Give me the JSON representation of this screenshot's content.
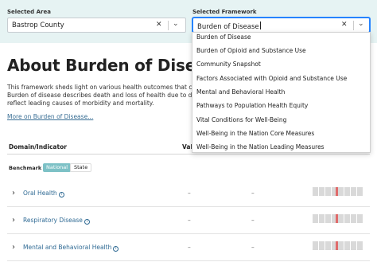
{
  "area": {
    "label": "Selected Area",
    "value": "Bastrop County",
    "clear_icon": "close-icon",
    "chevron_icon": "chevron-down-icon"
  },
  "framework": {
    "label": "Selected Framework",
    "value": "Burden of Disease",
    "clear_icon": "close-icon",
    "chevron_icon": "chevron-down-icon"
  },
  "dropdown": {
    "options": [
      "Burden of Disease",
      "Burden of Opioid and Substance Use",
      "Community Snapshot",
      "Factors Associated with Opioid and Substance Use",
      "Mental and Behavioral Health",
      "Pathways to Population Health Equity",
      "Vital Conditions for Well-Being",
      "Well-Being in the Nation Core Measures",
      "Well-Being in the Nation Leading Measures"
    ]
  },
  "main": {
    "title": "About Burden of Disease",
    "description_line1": "This framework sheds light on various health outcomes that co",
    "description_line2": "Burden of disease describes death and loss of health due to dis",
    "description_line3": "reflect leading causes of morbidity and mortality.",
    "more_link": "More on Burden of Disease..."
  },
  "table": {
    "col_indicator": "Domain/Indicator",
    "col_value": "Valu",
    "benchmark_label": "Benchmark",
    "benchmark_options": [
      "National",
      "State"
    ],
    "benchmark_selected": "National",
    "rows": [
      {
        "name": "Oral Health",
        "value": "–",
        "benchmark": "–"
      },
      {
        "name": "Respiratory Disease",
        "value": "–",
        "benchmark": "–"
      },
      {
        "name": "Mental and Behavioral Health",
        "value": "–",
        "benchmark": "–"
      }
    ]
  },
  "colors": {
    "topbar_bg": "#e6f3f3",
    "link": "#2f6a94",
    "pill_active": "#7dc1c6",
    "bar_marker": "#e06b6b",
    "bar_cell": "#d9d9d9"
  }
}
